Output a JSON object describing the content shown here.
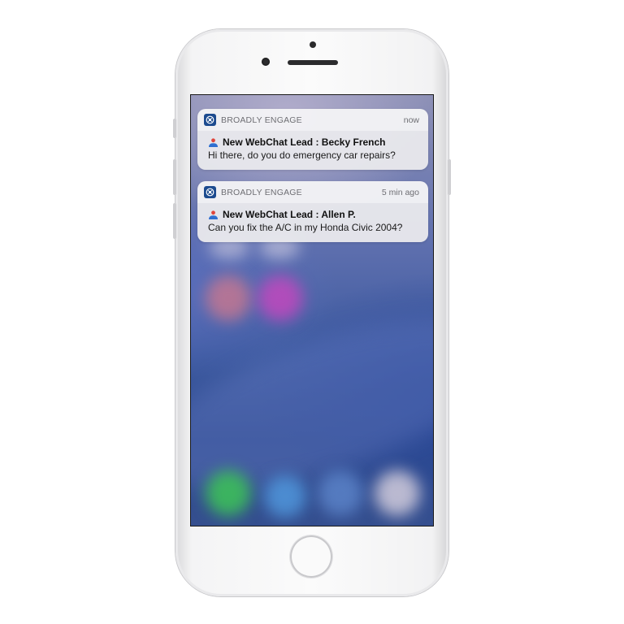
{
  "notifications": [
    {
      "app_name": "BROADLY ENGAGE",
      "time": "now",
      "title": "New WebChat Lead : Becky French",
      "message": "Hi there, do you do emergency car repairs?",
      "app_icon": "broadly-logo-icon",
      "title_icon": "lead-person-icon"
    },
    {
      "app_name": "BROADLY ENGAGE",
      "time": "5 min ago",
      "title": "New WebChat Lead : Allen P.",
      "message": "Can you fix the A/C in my Honda Civic 2004?",
      "app_icon": "broadly-logo-icon",
      "title_icon": "lead-person-icon"
    }
  ],
  "colors": {
    "app_icon_bg": "#1d4b8f",
    "lead_icon_red": "#e0443a",
    "lead_icon_blue": "#2f6fd0",
    "wallpaper_base": "#34508a"
  }
}
